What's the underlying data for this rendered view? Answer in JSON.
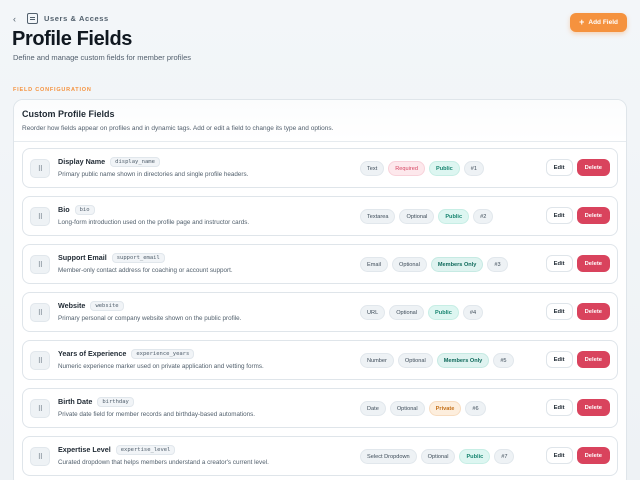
{
  "breadcrumb": {
    "back_icon": "chevron-left-icon",
    "section_icon": "list-icon",
    "label": "Users & Access"
  },
  "header": {
    "title": "Profile Fields",
    "subtitle": "Define and manage custom fields for member profiles",
    "add_button_label": "Add Field"
  },
  "section_label": "FIELD CONFIGURATION",
  "panel": {
    "title": "Custom Profile Fields",
    "description": "Reorder how fields appear on profiles and in dynamic tags. Add or edit a field to change its type and options."
  },
  "colors": {
    "accent": "#f5923e",
    "danger": "#d9435d",
    "public": "#16846f",
    "private": "#c47019"
  },
  "fields": [
    {
      "name": "Display Name",
      "key": "display_name",
      "description": "Primary public name shown in directories and single profile headers.",
      "type": "Text",
      "requirement": "Required",
      "visibility": "Public",
      "order": "#1"
    },
    {
      "name": "Bio",
      "key": "bio",
      "description": "Long-form introduction used on the profile page and instructor cards.",
      "type": "Textarea",
      "requirement": "Optional",
      "visibility": "Public",
      "order": "#2"
    },
    {
      "name": "Support Email",
      "key": "support_email",
      "description": "Member-only contact address for coaching or account support.",
      "type": "Email",
      "requirement": "Optional",
      "visibility": "Members Only",
      "order": "#3"
    },
    {
      "name": "Website",
      "key": "website",
      "description": "Primary personal or company website shown on the public profile.",
      "type": "URL",
      "requirement": "Optional",
      "visibility": "Public",
      "order": "#4"
    },
    {
      "name": "Years of Experience",
      "key": "experience_years",
      "description": "Numeric experience marker used on private application and vetting forms.",
      "type": "Number",
      "requirement": "Optional",
      "visibility": "Members Only",
      "order": "#5"
    },
    {
      "name": "Birth Date",
      "key": "birthday",
      "description": "Private date field for member records and birthday-based automations.",
      "type": "Date",
      "requirement": "Optional",
      "visibility": "Private",
      "order": "#6"
    },
    {
      "name": "Expertise Level",
      "key": "expertise_level",
      "description": "Curated dropdown that helps members understand a creator's current level.",
      "type": "Select Dropdown",
      "requirement": "Optional",
      "visibility": "Public",
      "order": "#7"
    }
  ],
  "row_actions": {
    "edit_label": "Edit",
    "delete_label": "Delete"
  }
}
